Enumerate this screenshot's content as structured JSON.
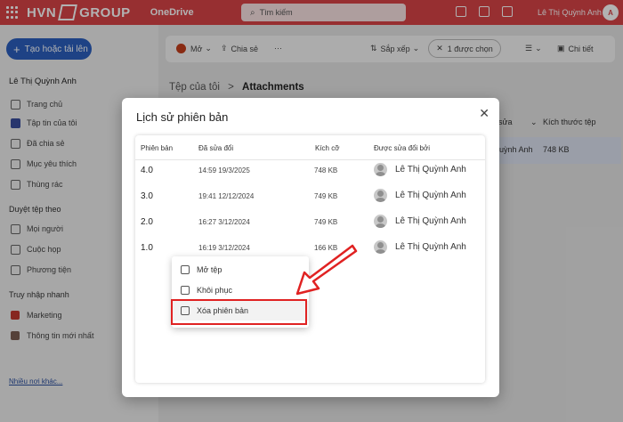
{
  "topbar": {
    "brand_left": "HVN",
    "brand_right": "GROUP",
    "app_name": "OneDrive",
    "search_placeholder": "Tìm kiếm",
    "user_name": "Lê Thị Quỳnh Anh",
    "avatar_initial": "A"
  },
  "sidebar": {
    "new_button": "Tạo hoặc tải lên",
    "user": "Lê Thị Quỳnh Anh",
    "items": [
      {
        "label": "Trang chủ",
        "icon": "home-icon"
      },
      {
        "label": "Tập tin của tôi",
        "icon": "folder-icon"
      },
      {
        "label": "Đã chia sẻ",
        "icon": "people-icon"
      },
      {
        "label": "Mục yêu thích",
        "icon": "star-icon"
      },
      {
        "label": "Thùng rác",
        "icon": "trash-icon"
      }
    ],
    "browse_heading": "Duyệt tệp theo",
    "browse_items": [
      {
        "label": "Mọi người",
        "icon": "person-icon"
      },
      {
        "label": "Cuộc họp",
        "icon": "calendar-icon"
      },
      {
        "label": "Phương tiện",
        "icon": "image-icon"
      }
    ],
    "quick_heading": "Truy nhập nhanh",
    "quick_items": [
      {
        "label": "Marketing"
      },
      {
        "label": "Thông tin mới nhất"
      }
    ],
    "more_link": "Nhiều nơi khác..."
  },
  "commandbar": {
    "open": "Mở",
    "share": "Chia sẻ",
    "more": "···",
    "sort": "Sắp xếp",
    "selected": "1 được chọn",
    "details": "Chi tiết"
  },
  "breadcrumb": {
    "parent": "Tệp của tôi",
    "separator": ">",
    "current": "Attachments"
  },
  "background_table": {
    "col_modified_partial": "sửa",
    "col_size": "Kích thước tệp",
    "row_modified_by_partial": "uỳnh Anh",
    "row_size": "748 KB"
  },
  "dialog": {
    "title": "Lịch sử phiên bản",
    "close": "✕",
    "columns": [
      "Phiên bản",
      "Đã sửa đổi",
      "Kích cỡ",
      "Được sửa đổi bởi"
    ],
    "rows": [
      {
        "version": "4.0",
        "modified": "14:59 19/3/2025",
        "size": "748 KB",
        "by": "Lê Thị Quỳnh Anh"
      },
      {
        "version": "3.0",
        "modified": "19:41 12/12/2024",
        "size": "749 KB",
        "by": "Lê Thị Quỳnh Anh"
      },
      {
        "version": "2.0",
        "modified": "16:27 3/12/2024",
        "size": "749 KB",
        "by": "Lê Thị Quỳnh Anh"
      },
      {
        "version": "1.0",
        "modified": "16:19 3/12/2024",
        "size": "166 KB",
        "by": "Lê Thị Quỳnh Anh"
      }
    ],
    "context_menu": [
      {
        "label": "Mở tệp",
        "icon": "open-file-icon"
      },
      {
        "label": "Khôi phục",
        "icon": "restore-icon"
      },
      {
        "label": "Xóa phiên bản",
        "icon": "trash-icon"
      }
    ]
  },
  "colors": {
    "topbar": "#d84447",
    "primary_button": "#2b5fbf",
    "highlight_red": "#e02222"
  }
}
